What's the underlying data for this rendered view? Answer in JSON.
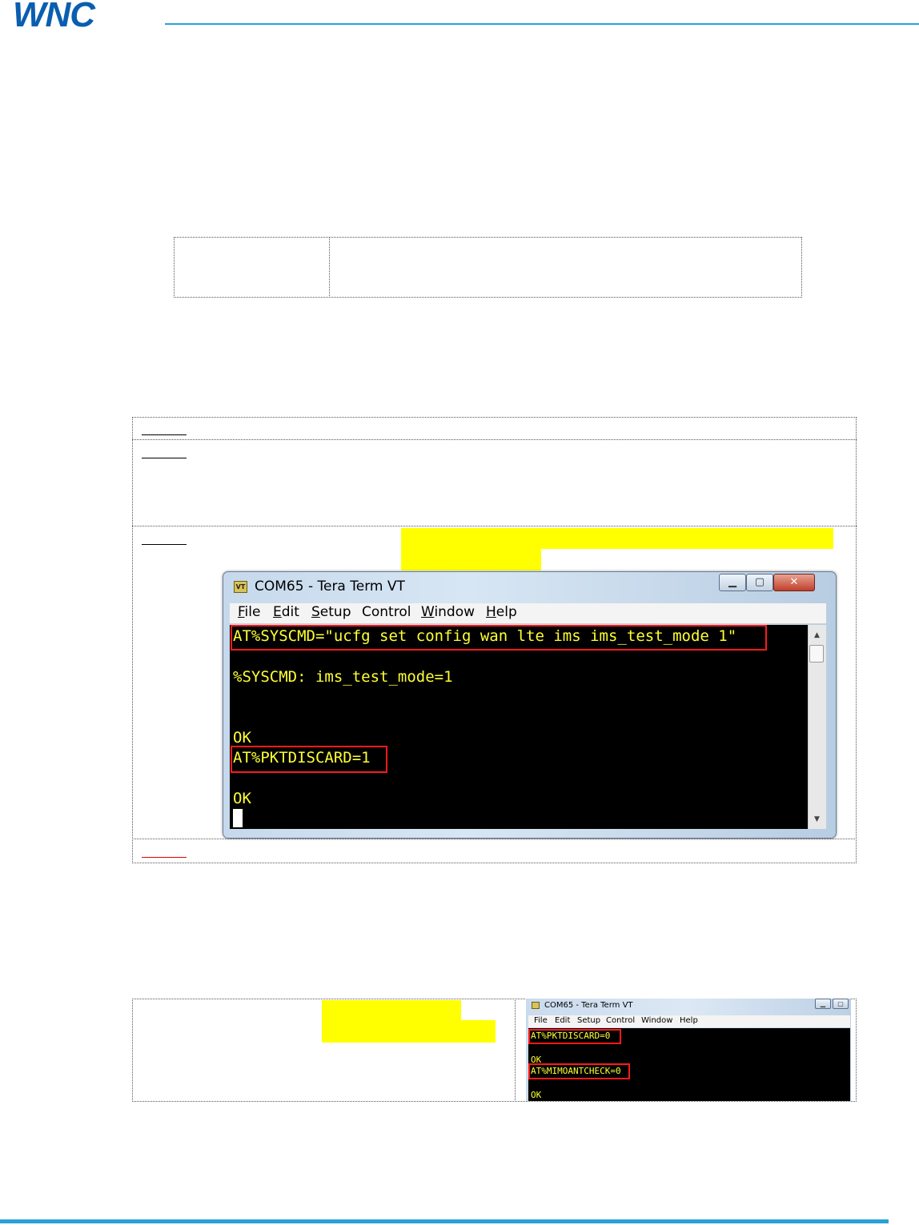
{
  "header": {
    "logo_text": "WNC",
    "brand_color": "#0a5eb0",
    "rule_color": "#2aa0dc"
  },
  "terminal": {
    "title": "COM65 - Tera Term VT",
    "icon_text": "VT",
    "window_buttons": {
      "minimize": "▁",
      "maximize": "▢",
      "close": "✕"
    },
    "menu": [
      {
        "first": "F",
        "rest": "ile"
      },
      {
        "first": "E",
        "rest": "dit"
      },
      {
        "first": "S",
        "rest": "etup"
      },
      {
        "first": "C",
        "rest": "ontrol",
        "prefix": ""
      },
      {
        "first": "W",
        "rest": "indow"
      },
      {
        "first": "H",
        "rest": "elp"
      }
    ],
    "lines": [
      "AT%SYSCMD=\"ucfg set config wan lte ims ims_test_mode 1\"",
      "%SYSCMD: ims_test_mode=1",
      "OK",
      "AT%PKTDISCARD=1",
      "OK"
    ],
    "scroll_up": "▲",
    "scroll_down": "▼",
    "text_color": "#ffff33",
    "highlight_color": "#ff1a1a"
  },
  "small_terminal": {
    "title": "COM65 - Tera Term VT",
    "menu": [
      "File",
      "Edit",
      "Setup",
      "Control",
      "Window",
      "Help"
    ],
    "lines": [
      "AT%PKTDISCARD=0",
      "OK",
      "AT%MIMOANTCHECK=0",
      "OK"
    ]
  },
  "colors": {
    "text_highlight": "#ffff00",
    "footer_rule": "#2aa0dc",
    "warning_underline": "#e00000"
  }
}
